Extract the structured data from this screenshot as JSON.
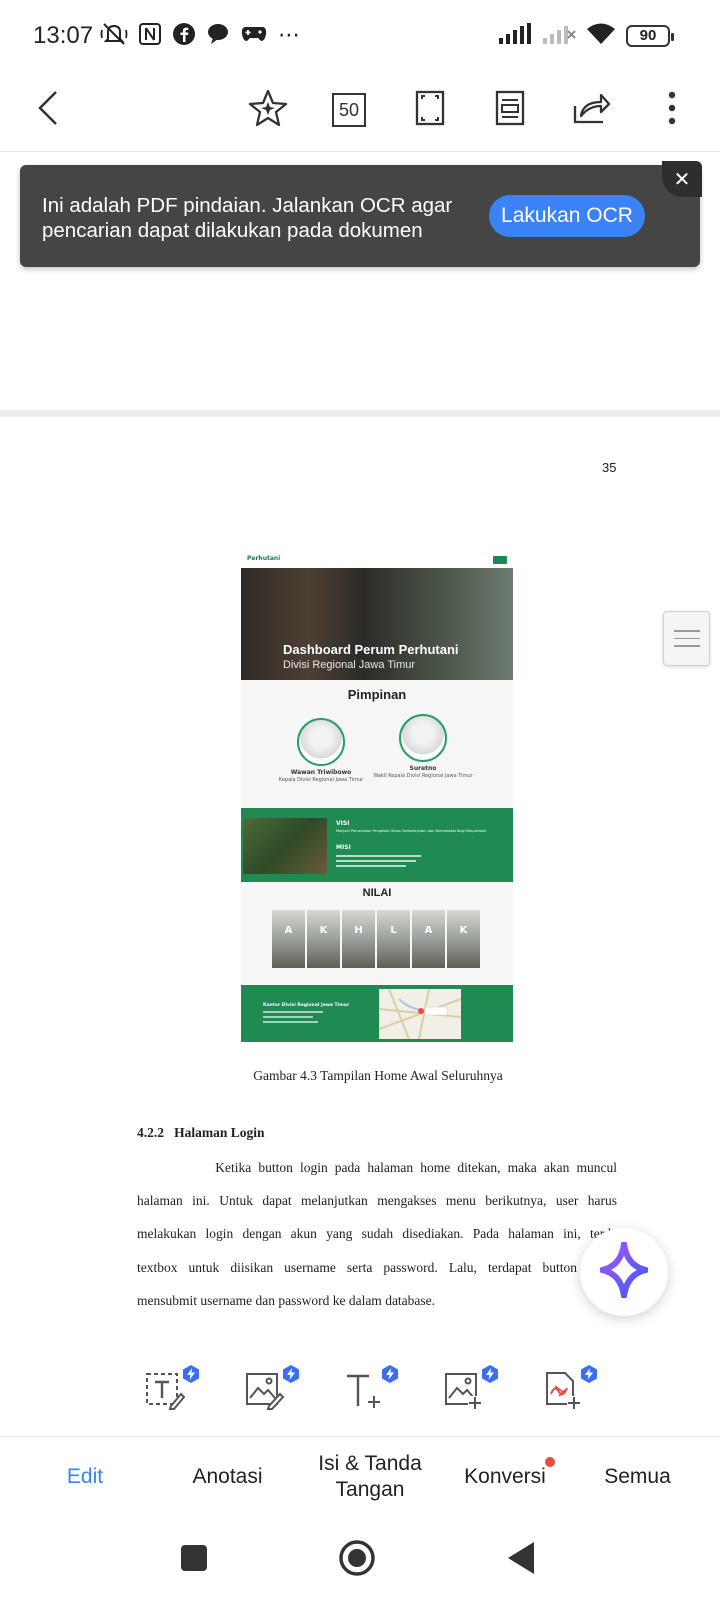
{
  "status_bar": {
    "time": "13:07",
    "battery": "90",
    "icons": [
      "mute-icon",
      "nfc-icon",
      "facebook-icon",
      "chat-icon",
      "game-icon",
      "more-icon",
      "signal-icon",
      "signal-off-icon",
      "wifi-icon"
    ]
  },
  "toolbar": {
    "page_count": "50",
    "icons": [
      "back-icon",
      "ai-star-icon",
      "page-count-icon",
      "fullscreen-icon",
      "reading-mode-icon",
      "share-icon",
      "more-vertical-icon"
    ]
  },
  "ocr_banner": {
    "message": "Ini adalah PDF pindaian. Jalankan OCR agar pencarian dapat dilakukan pada dokumen",
    "button": "Lakukan OCR"
  },
  "document": {
    "page_number": "35",
    "figure": {
      "logo": "Perhutani",
      "hero_title": "Dashboard Perum Perhutani",
      "hero_subtitle": "Divisi Regional Jawa Timur",
      "leaders_title": "Pimpinan",
      "leader1_name": "Wawan Triwibowo",
      "leader1_role": "Kepala Divisi Regional Jawa Timur",
      "leader2_name": "Suretno",
      "leader2_role": "Wakil Kepala Divisi Regional Jawa Timur",
      "visi_title": "VISI",
      "visi_text": "Menjadi Perusahaan Pengelola Hutan Berkelanjutan dan Bermanfaat Bagi Masyarakat",
      "misi_title": "MISI",
      "nilai_title": "NILAI",
      "nilai": [
        "A",
        "K",
        "H",
        "L",
        "A",
        "K"
      ],
      "footer_title": "Kantor Divisi Regional Jawa Timur"
    },
    "caption": "Gambar 4.3 Tampilan Home Awal Seluruhnya",
    "section_heading": "4.2.2   Halaman Login",
    "paragraph_lines": [
      "           Ketika button login pada halaman home ditekan, maka akan muncul",
      "halaman ini. Untuk dapat melanjutkan mengakses menu berikutnya, user harus",
      "melakukan login dengan akun yang sudah disediakan. Pada halaman ini, terda",
      "textbox untuk diisikan username serta password. Lalu, terdapat button",
      "mensubmit username dan password ke dalam database."
    ]
  },
  "quick_tools": [
    "edit-text-icon",
    "edit-image-icon",
    "add-text-icon",
    "add-image-icon",
    "sign-document-icon"
  ],
  "tabs": {
    "edit": "Edit",
    "anotasi": "Anotasi",
    "isi_tanda_tangan": "Isi & Tanda Tangan",
    "konversi": "Konversi",
    "semua": "Semua"
  },
  "colors": {
    "accent": "#3b82f6",
    "banner_bg": "#454545",
    "figure_green": "#1f8a52",
    "notification_dot": "#e74c3c"
  }
}
